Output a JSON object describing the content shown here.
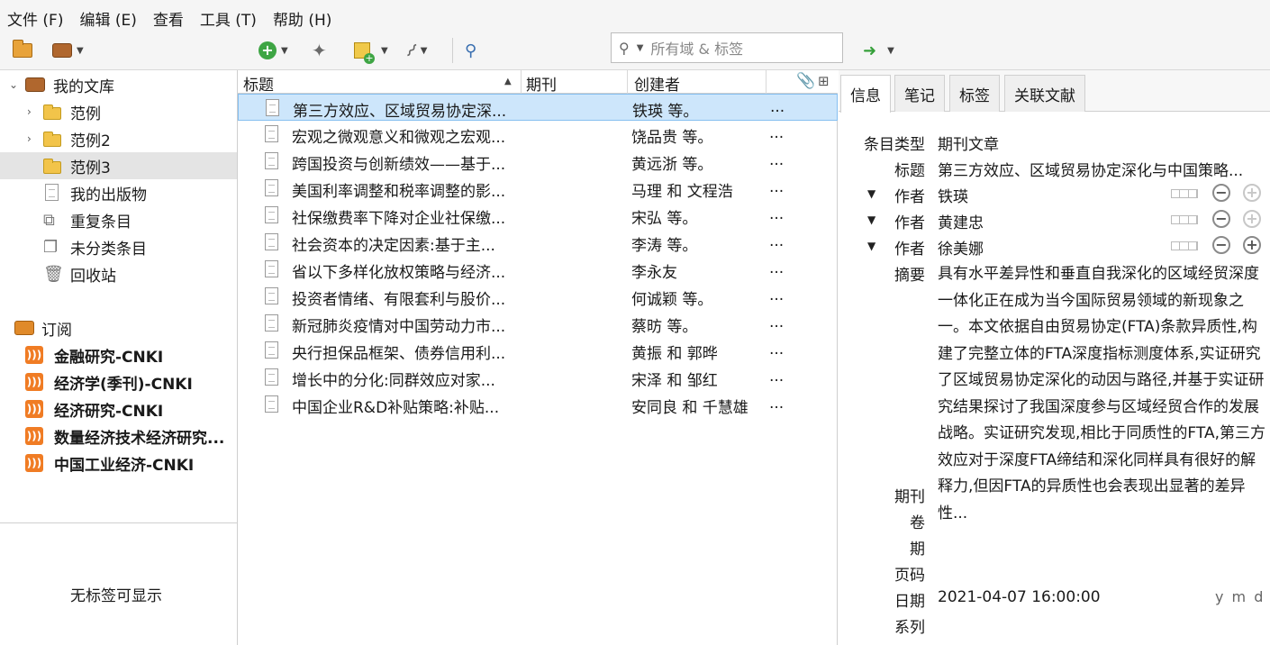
{
  "menu": [
    "文件 (F)",
    "编辑 (E)",
    "查看",
    "工具 (T)",
    "帮助 (H)"
  ],
  "search": {
    "placeholder": "所有域 & 标签"
  },
  "sidebar": {
    "library": "我的文库",
    "collections": [
      "范例",
      "范例2",
      "范例3"
    ],
    "specials": [
      "我的出版物",
      "重复条目",
      "未分类条目",
      "回收站"
    ],
    "feeds_label": "订阅",
    "feeds": [
      "金融研究-CNKI",
      "经济学(季刊)-CNKI",
      "经济研究-CNKI",
      "数量经济技术经济研究...",
      "中国工业经济-CNKI"
    ],
    "no_tags": "无标签可显示"
  },
  "columns": {
    "title": "标题",
    "journal": "期刊",
    "creator": "创建者"
  },
  "items": [
    {
      "title": "第三方效应、区域贸易协定深...",
      "creator": "铁瑛 等。",
      "more": "..."
    },
    {
      "title": "宏观之微观意义和微观之宏观...",
      "creator": "饶品贵 等。",
      "more": "..."
    },
    {
      "title": "跨国投资与创新绩效——基于...",
      "creator": "黄远浙 等。",
      "more": "..."
    },
    {
      "title": "美国利率调整和税率调整的影...",
      "creator": "马理 和 文程浩",
      "more": "..."
    },
    {
      "title": "社保缴费率下降对企业社保缴...",
      "creator": "宋弘 等。",
      "more": "..."
    },
    {
      "title": "社会资本的决定因素:基于主...",
      "creator": "李涛 等。",
      "more": "..."
    },
    {
      "title": "省以下多样化放权策略与经济...",
      "creator": "李永友",
      "more": "..."
    },
    {
      "title": "投资者情绪、有限套利与股价...",
      "creator": "何诚颖 等。",
      "more": "..."
    },
    {
      "title": "新冠肺炎疫情对中国劳动力市...",
      "creator": "蔡昉 等。",
      "more": "..."
    },
    {
      "title": "央行担保品框架、债券信用利...",
      "creator": "黄振 和 郭晔",
      "more": "..."
    },
    {
      "title": "增长中的分化:同群效应对家...",
      "creator": "宋泽 和 邹红",
      "more": "..."
    },
    {
      "title": "中国企业R&D补贴策略:补贴...",
      "creator": "安同良 和 千慧雄",
      "more": "..."
    }
  ],
  "tabs": [
    "信息",
    "笔记",
    "标签",
    "关联文献"
  ],
  "info": {
    "item_type_label": "条目类型",
    "item_type": "期刊文章",
    "title_label": "标题",
    "title": "第三方效应、区域贸易协定深化与中国策略...",
    "author_label": "作者",
    "authors": [
      "铁瑛",
      "黄建忠",
      "徐美娜"
    ],
    "abstract_label": "摘要",
    "abstract": "具有水平差异性和垂直自我深化的区域经贸深度一体化正在成为当今国际贸易领域的新现象之一。本文依据自由贸易协定(FTA)条款异质性,构建了完整立体的FTA深度指标测度体系,实证研究了区域贸易协定深化的动因与路径,并基于实证研究结果探讨了我国深度参与区域经贸合作的发展战略。实证研究发现,相比于同质性的FTA,第三方效应对于深度FTA缔结和深化同样具有很好的解释力,但因FTA的异质性也会表现出显著的差异性...",
    "journal_label": "期刊",
    "volume_label": "卷",
    "issue_label": "期",
    "pages_label": "页码",
    "date_label": "日期",
    "date": "2021-04-07 16:00:00",
    "date_format": "y m d",
    "series_label": "系列"
  }
}
